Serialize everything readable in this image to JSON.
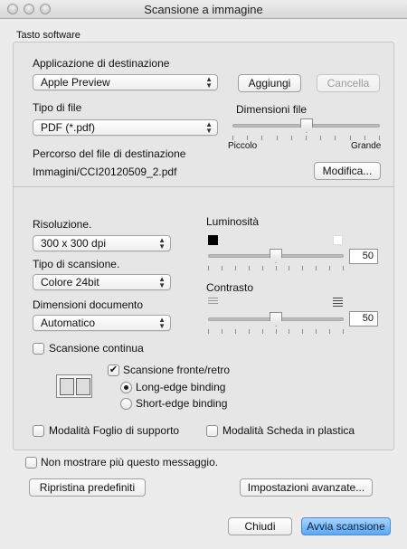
{
  "window": {
    "title": "Scansione a immagine"
  },
  "software_group": {
    "title": "Tasto software"
  },
  "destination": {
    "app_label": "Applicazione di destinazione",
    "app_value": "Apple Preview",
    "add_label": "Aggiungi",
    "delete_label": "Cancella",
    "filetype_label": "Tipo di file",
    "filetype_value": "PDF (*.pdf)",
    "filesize_label": "Dimensioni file",
    "filesize_min": "Piccolo",
    "filesize_max": "Grande",
    "filesize_level": 0.5,
    "path_label": "Percorso del file di destinazione",
    "path_value": "Immagini/CCI20120509_2.pdf",
    "modify_label": "Modifica..."
  },
  "scan": {
    "resolution_label": "Risoluzione.",
    "resolution_value": "300 x 300 dpi",
    "scantype_label": "Tipo di scansione.",
    "scantype_value": "Colore 24bit",
    "docsize_label": "Dimensioni documento",
    "docsize_value": "Automatico",
    "brightness_label": "Luminosità",
    "brightness_value": "50",
    "contrast_label": "Contrasto",
    "contrast_value": "50",
    "continuous_label": "Scansione continua",
    "continuous_checked": false,
    "duplex_label": "Scansione fronte/retro",
    "duplex_checked": true,
    "long_edge_label": "Long-edge binding",
    "short_edge_label": "Short-edge binding",
    "binding_selected": "long-edge",
    "carrier_label": "Modalità Foglio di supporto",
    "plastic_label": "Modalità Scheda in plastica"
  },
  "footer": {
    "dont_show_label": "Non mostrare più questo messaggio.",
    "restore_label": "Ripristina predefiniti",
    "advanced_label": "Impostazioni avanzate...",
    "close_label": "Chiudi",
    "start_label": "Avvia scansione"
  },
  "colors": {
    "accent": "#5aa7f3",
    "background": "#ececec"
  }
}
